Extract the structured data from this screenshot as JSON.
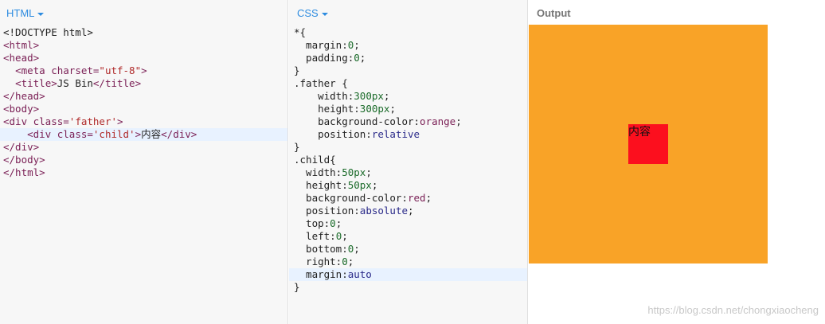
{
  "panels": {
    "html": {
      "label": "HTML"
    },
    "css": {
      "label": "CSS"
    },
    "output": {
      "label": "Output"
    }
  },
  "html_code": {
    "l1": "<!DOCTYPE html>",
    "l2": "<html>",
    "l3": "<head>",
    "l4_indent": "  ",
    "l4_tag": "<meta charset=",
    "l4_str": "\"utf-8\"",
    "l4_end": ">",
    "l5_indent": "  ",
    "l5_open": "<title>",
    "l5_text": "JS Bin",
    "l5_close": "</title>",
    "l6": "</head>",
    "l7": "<body>",
    "l8_tag": "<div class=",
    "l8_str": "'father'",
    "l8_end": ">",
    "l9_indent": "    ",
    "l9_tag": "<div class=",
    "l9_str": "'child'",
    "l9_end": ">",
    "l9_text": "内容",
    "l9_close": "</div>",
    "l10": "</div>",
    "l11": "</body>",
    "l12": "</html>"
  },
  "css_code": {
    "l1": "*{",
    "l2_prop": "  margin:",
    "l2_val": "0",
    "l2_end": ";",
    "l3_prop": "  padding:",
    "l3_val": "0",
    "l3_end": ";",
    "l4": "}",
    "l5": ".father {",
    "l6_prop": "    width:",
    "l6_val": "300px",
    "l6_end": ";",
    "l7_prop": "    height:",
    "l7_val": "300px",
    "l7_end": ";",
    "l8_prop": "    background-color:",
    "l8_val": "orange",
    "l8_end": ";",
    "l9_prop": "    position:",
    "l9_val": "relative",
    "l9_end": "",
    "l10": "}",
    "l11": ".child{",
    "l12_prop": "  width:",
    "l12_val": "50px",
    "l12_end": ";",
    "l13_prop": "  height:",
    "l13_val": "50px",
    "l13_end": ";",
    "l14_prop": "  background-color:",
    "l14_val": "red",
    "l14_end": ";",
    "l15_prop": "  position:",
    "l15_val": "absolute",
    "l15_end": ";",
    "l16_prop": "  top:",
    "l16_val": "0",
    "l16_end": ";",
    "l17_prop": "  left:",
    "l17_val": "0",
    "l17_end": ";",
    "l18_prop": "  bottom:",
    "l18_val": "0",
    "l18_end": ";",
    "l19_prop": "  right:",
    "l19_val": "0",
    "l19_end": ";",
    "l20_prop": "  margin:",
    "l20_val": "auto",
    "l20_end": "",
    "l21": "}"
  },
  "output": {
    "child_text": "内容"
  },
  "watermark": "https://blog.csdn.net/chongxiaocheng",
  "colors": {
    "accent": "#2d8ce0",
    "father_bg": "#f9a327",
    "child_bg": "#fc0f1e",
    "active_line": "#e8f2ff"
  }
}
